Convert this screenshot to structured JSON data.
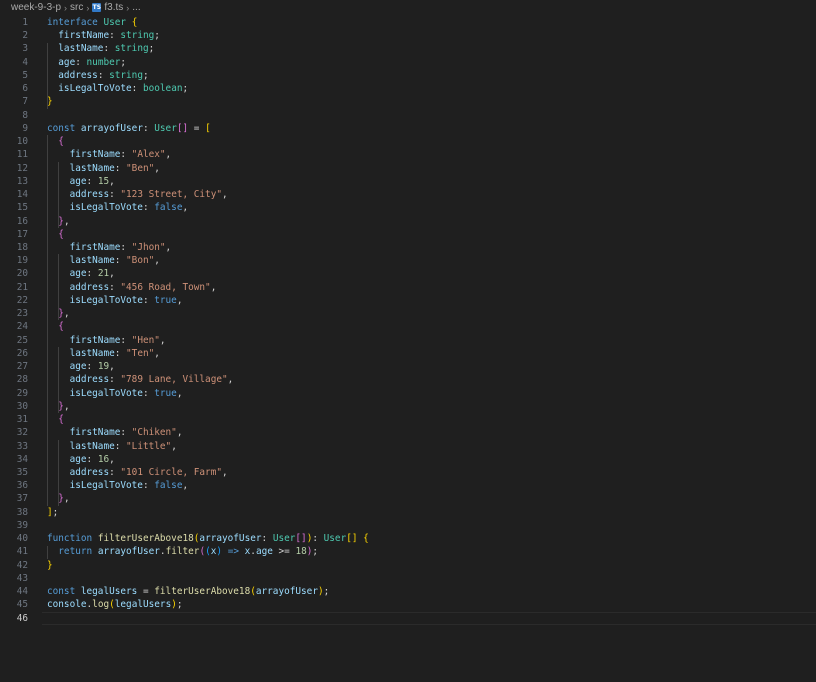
{
  "breadcrumb": {
    "folder": "week-9-3-p",
    "subfolder": "src",
    "file": "f3.ts",
    "ellipsis": "...",
    "file_icon": "typescript-file-icon"
  },
  "editor": {
    "active_line": 46,
    "lines": [
      [
        [
          "kw",
          "interface "
        ],
        [
          "ty",
          "User "
        ],
        [
          "b1",
          "{"
        ]
      ],
      [
        [
          "pr",
          "  firstName"
        ],
        [
          "op",
          ": "
        ],
        [
          "ty",
          "string"
        ],
        [
          "op",
          ";"
        ]
      ],
      [
        [
          "pr",
          "  lastName"
        ],
        [
          "op",
          ": "
        ],
        [
          "ty",
          "string"
        ],
        [
          "op",
          ";"
        ]
      ],
      [
        [
          "pr",
          "  age"
        ],
        [
          "op",
          ": "
        ],
        [
          "ty",
          "number"
        ],
        [
          "op",
          ";"
        ]
      ],
      [
        [
          "pr",
          "  address"
        ],
        [
          "op",
          ": "
        ],
        [
          "ty",
          "string"
        ],
        [
          "op",
          ";"
        ]
      ],
      [
        [
          "pr",
          "  isLegalToVote"
        ],
        [
          "op",
          ": "
        ],
        [
          "ty",
          "boolean"
        ],
        [
          "op",
          ";"
        ]
      ],
      [
        [
          "b1",
          "}"
        ]
      ],
      [],
      [
        [
          "kw",
          "const "
        ],
        [
          "pr",
          "arrayofUser"
        ],
        [
          "op",
          ": "
        ],
        [
          "ty",
          "User"
        ],
        [
          "b2",
          "[]"
        ],
        [
          "op",
          " = "
        ],
        [
          "b1",
          "["
        ]
      ],
      [
        [
          "b2",
          "  {"
        ]
      ],
      [
        [
          "pr",
          "    firstName"
        ],
        [
          "op",
          ": "
        ],
        [
          "st",
          "\"Alex\""
        ],
        [
          "op",
          ","
        ]
      ],
      [
        [
          "pr",
          "    lastName"
        ],
        [
          "op",
          ": "
        ],
        [
          "st",
          "\"Ben\""
        ],
        [
          "op",
          ","
        ]
      ],
      [
        [
          "pr",
          "    age"
        ],
        [
          "op",
          ": "
        ],
        [
          "nu",
          "15"
        ],
        [
          "op",
          ","
        ]
      ],
      [
        [
          "pr",
          "    address"
        ],
        [
          "op",
          ": "
        ],
        [
          "st",
          "\"123 Street, City\""
        ],
        [
          "op",
          ","
        ]
      ],
      [
        [
          "pr",
          "    isLegalToVote"
        ],
        [
          "op",
          ": "
        ],
        [
          "kw",
          "false"
        ],
        [
          "op",
          ","
        ]
      ],
      [
        [
          "b2",
          "  }"
        ],
        [
          "op",
          ","
        ]
      ],
      [
        [
          "b2",
          "  {"
        ]
      ],
      [
        [
          "pr",
          "    firstName"
        ],
        [
          "op",
          ": "
        ],
        [
          "st",
          "\"Jhon\""
        ],
        [
          "op",
          ","
        ]
      ],
      [
        [
          "pr",
          "    lastName"
        ],
        [
          "op",
          ": "
        ],
        [
          "st",
          "\"Bon\""
        ],
        [
          "op",
          ","
        ]
      ],
      [
        [
          "pr",
          "    age"
        ],
        [
          "op",
          ": "
        ],
        [
          "nu",
          "21"
        ],
        [
          "op",
          ","
        ]
      ],
      [
        [
          "pr",
          "    address"
        ],
        [
          "op",
          ": "
        ],
        [
          "st",
          "\"456 Road, Town\""
        ],
        [
          "op",
          ","
        ]
      ],
      [
        [
          "pr",
          "    isLegalToVote"
        ],
        [
          "op",
          ": "
        ],
        [
          "kw",
          "true"
        ],
        [
          "op",
          ","
        ]
      ],
      [
        [
          "b2",
          "  }"
        ],
        [
          "op",
          ","
        ]
      ],
      [
        [
          "b2",
          "  {"
        ]
      ],
      [
        [
          "pr",
          "    firstName"
        ],
        [
          "op",
          ": "
        ],
        [
          "st",
          "\"Hen\""
        ],
        [
          "op",
          ","
        ]
      ],
      [
        [
          "pr",
          "    lastName"
        ],
        [
          "op",
          ": "
        ],
        [
          "st",
          "\"Ten\""
        ],
        [
          "op",
          ","
        ]
      ],
      [
        [
          "pr",
          "    age"
        ],
        [
          "op",
          ": "
        ],
        [
          "nu",
          "19"
        ],
        [
          "op",
          ","
        ]
      ],
      [
        [
          "pr",
          "    address"
        ],
        [
          "op",
          ": "
        ],
        [
          "st",
          "\"789 Lane, Village\""
        ],
        [
          "op",
          ","
        ]
      ],
      [
        [
          "pr",
          "    isLegalToVote"
        ],
        [
          "op",
          ": "
        ],
        [
          "kw",
          "true"
        ],
        [
          "op",
          ","
        ]
      ],
      [
        [
          "b2",
          "  }"
        ],
        [
          "op",
          ","
        ]
      ],
      [
        [
          "b2",
          "  {"
        ]
      ],
      [
        [
          "pr",
          "    firstName"
        ],
        [
          "op",
          ": "
        ],
        [
          "st",
          "\"Chiken\""
        ],
        [
          "op",
          ","
        ]
      ],
      [
        [
          "pr",
          "    lastName"
        ],
        [
          "op",
          ": "
        ],
        [
          "st",
          "\"Little\""
        ],
        [
          "op",
          ","
        ]
      ],
      [
        [
          "pr",
          "    age"
        ],
        [
          "op",
          ": "
        ],
        [
          "nu",
          "16"
        ],
        [
          "op",
          ","
        ]
      ],
      [
        [
          "pr",
          "    address"
        ],
        [
          "op",
          ": "
        ],
        [
          "st",
          "\"101 Circle, Farm\""
        ],
        [
          "op",
          ","
        ]
      ],
      [
        [
          "pr",
          "    isLegalToVote"
        ],
        [
          "op",
          ": "
        ],
        [
          "kw",
          "false"
        ],
        [
          "op",
          ","
        ]
      ],
      [
        [
          "b2",
          "  }"
        ],
        [
          "op",
          ","
        ]
      ],
      [
        [
          "b1",
          "]"
        ],
        [
          "op",
          ";"
        ]
      ],
      [],
      [
        [
          "kw",
          "function "
        ],
        [
          "fn",
          "filterUserAbove18"
        ],
        [
          "b1",
          "("
        ],
        [
          "pr",
          "arrayofUser"
        ],
        [
          "op",
          ": "
        ],
        [
          "ty",
          "User"
        ],
        [
          "b2",
          "[]"
        ],
        [
          "b1",
          ")"
        ],
        [
          "op",
          ": "
        ],
        [
          "ty",
          "User"
        ],
        [
          "b1",
          "[] {"
        ]
      ],
      [
        [
          "kw",
          "  return "
        ],
        [
          "pr",
          "arrayofUser"
        ],
        [
          "op",
          "."
        ],
        [
          "fn",
          "filter"
        ],
        [
          "b2",
          "("
        ],
        [
          "b3",
          "("
        ],
        [
          "pr",
          "x"
        ],
        [
          "b3",
          ")"
        ],
        [
          "kw",
          " => "
        ],
        [
          "pr",
          "x"
        ],
        [
          "op",
          "."
        ],
        [
          "pr",
          "age"
        ],
        [
          "op",
          " >= "
        ],
        [
          "nu",
          "18"
        ],
        [
          "b2",
          ")"
        ],
        [
          "op",
          ";"
        ]
      ],
      [
        [
          "b1",
          "}"
        ]
      ],
      [],
      [
        [
          "kw",
          "const "
        ],
        [
          "pr",
          "legalUsers"
        ],
        [
          "op",
          " = "
        ],
        [
          "fn",
          "filterUserAbove18"
        ],
        [
          "b1",
          "("
        ],
        [
          "pr",
          "arrayofUser"
        ],
        [
          "b1",
          ")"
        ],
        [
          "op",
          ";"
        ]
      ],
      [
        [
          "pr",
          "console"
        ],
        [
          "op",
          "."
        ],
        [
          "fn",
          "log"
        ],
        [
          "b1",
          "("
        ],
        [
          "pr",
          "legalUsers"
        ],
        [
          "b1",
          ")"
        ],
        [
          "op",
          ";"
        ]
      ],
      []
    ]
  }
}
